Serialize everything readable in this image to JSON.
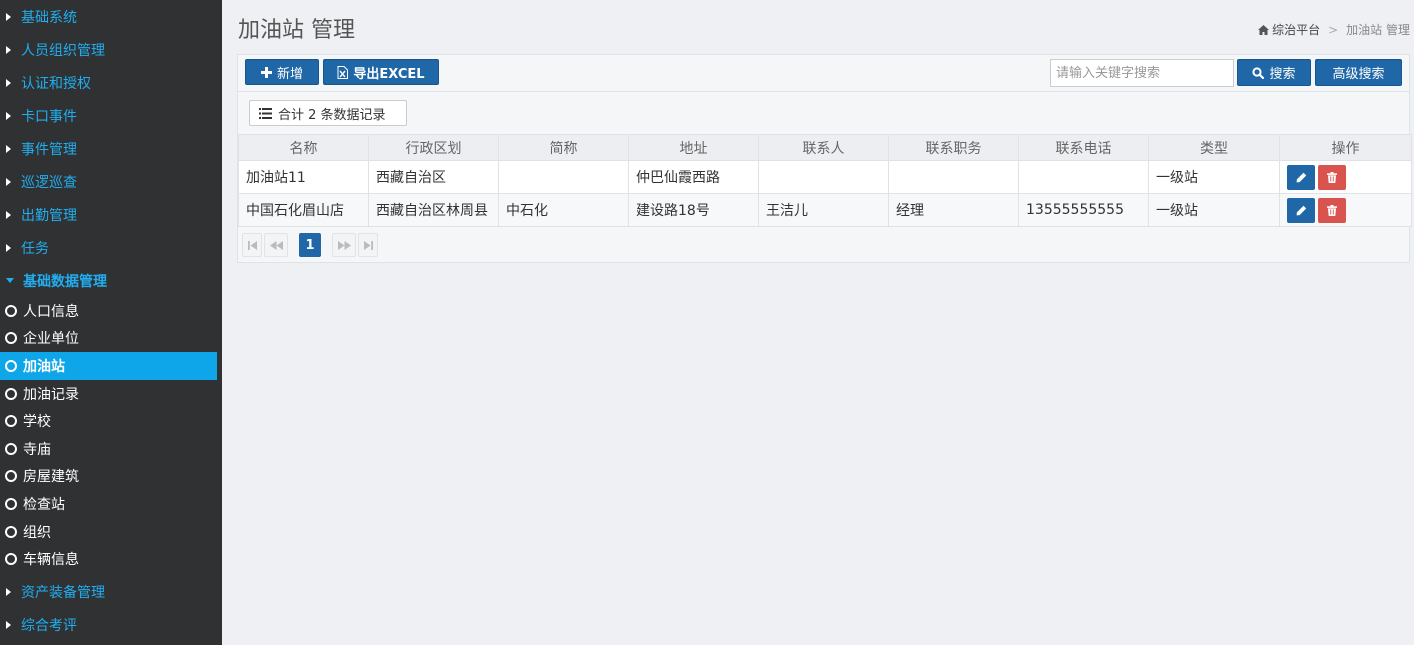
{
  "sidebar": {
    "groups_top": [
      {
        "label": "基础系统"
      },
      {
        "label": "人员组织管理"
      },
      {
        "label": "认证和授权"
      },
      {
        "label": "卡口事件"
      },
      {
        "label": "事件管理"
      },
      {
        "label": "巡逻巡查"
      },
      {
        "label": "出勤管理"
      },
      {
        "label": "任务"
      }
    ],
    "open_group": {
      "label": "基础数据管理"
    },
    "sub_items": [
      {
        "label": "人口信息"
      },
      {
        "label": "企业单位"
      },
      {
        "label": "加油站",
        "active": true
      },
      {
        "label": "加油记录"
      },
      {
        "label": "学校"
      },
      {
        "label": "寺庙"
      },
      {
        "label": "房屋建筑"
      },
      {
        "label": "检查站"
      },
      {
        "label": "组织"
      },
      {
        "label": "车辆信息"
      }
    ],
    "groups_bottom": [
      {
        "label": "资产装备管理"
      },
      {
        "label": "综合考评"
      }
    ]
  },
  "header": {
    "title": "加油站 管理",
    "breadcrumb": {
      "home": "综治平台",
      "separator": ">",
      "current": "加油站 管理"
    }
  },
  "toolbar": {
    "add_label": "新增",
    "export_label": "导出EXCEL",
    "search_placeholder": "请输入关键字搜索",
    "search_label": "搜索",
    "advanced_label": "高级搜索"
  },
  "record_count": "合计 2 条数据记录",
  "table": {
    "columns": [
      "名称",
      "行政区划",
      "简称",
      "地址",
      "联系人",
      "联系职务",
      "联系电话",
      "类型",
      "操作"
    ],
    "rows": [
      [
        "加油站11",
        "西藏自治区",
        "",
        "仲巴仙霞西路",
        "",
        "",
        "",
        "一级站"
      ],
      [
        "中国石化眉山店",
        "西藏自治区林周县",
        "中石化",
        "建设路18号",
        "王洁儿",
        "经理",
        "13555555555",
        "一级站"
      ]
    ]
  },
  "pager": {
    "current_page": "1"
  },
  "colors": {
    "sidebar_bg": "#2f3133",
    "accent": "#21aef0",
    "active_item": "#0ea5e9",
    "primary_button": "#1f67a6",
    "danger_button": "#d9534f"
  }
}
